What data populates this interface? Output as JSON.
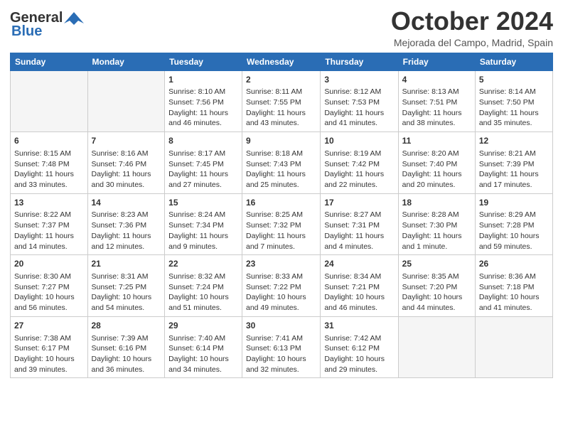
{
  "header": {
    "logo_line1": "General",
    "logo_line2": "Blue",
    "month": "October 2024",
    "location": "Mejorada del Campo, Madrid, Spain"
  },
  "days_of_week": [
    "Sunday",
    "Monday",
    "Tuesday",
    "Wednesday",
    "Thursday",
    "Friday",
    "Saturday"
  ],
  "weeks": [
    [
      {
        "day": "",
        "empty": true
      },
      {
        "day": "",
        "empty": true
      },
      {
        "day": "1",
        "sunrise": "Sunrise: 8:10 AM",
        "sunset": "Sunset: 7:56 PM",
        "daylight": "Daylight: 11 hours and 46 minutes."
      },
      {
        "day": "2",
        "sunrise": "Sunrise: 8:11 AM",
        "sunset": "Sunset: 7:55 PM",
        "daylight": "Daylight: 11 hours and 43 minutes."
      },
      {
        "day": "3",
        "sunrise": "Sunrise: 8:12 AM",
        "sunset": "Sunset: 7:53 PM",
        "daylight": "Daylight: 11 hours and 41 minutes."
      },
      {
        "day": "4",
        "sunrise": "Sunrise: 8:13 AM",
        "sunset": "Sunset: 7:51 PM",
        "daylight": "Daylight: 11 hours and 38 minutes."
      },
      {
        "day": "5",
        "sunrise": "Sunrise: 8:14 AM",
        "sunset": "Sunset: 7:50 PM",
        "daylight": "Daylight: 11 hours and 35 minutes."
      }
    ],
    [
      {
        "day": "6",
        "sunrise": "Sunrise: 8:15 AM",
        "sunset": "Sunset: 7:48 PM",
        "daylight": "Daylight: 11 hours and 33 minutes."
      },
      {
        "day": "7",
        "sunrise": "Sunrise: 8:16 AM",
        "sunset": "Sunset: 7:46 PM",
        "daylight": "Daylight: 11 hours and 30 minutes."
      },
      {
        "day": "8",
        "sunrise": "Sunrise: 8:17 AM",
        "sunset": "Sunset: 7:45 PM",
        "daylight": "Daylight: 11 hours and 27 minutes."
      },
      {
        "day": "9",
        "sunrise": "Sunrise: 8:18 AM",
        "sunset": "Sunset: 7:43 PM",
        "daylight": "Daylight: 11 hours and 25 minutes."
      },
      {
        "day": "10",
        "sunrise": "Sunrise: 8:19 AM",
        "sunset": "Sunset: 7:42 PM",
        "daylight": "Daylight: 11 hours and 22 minutes."
      },
      {
        "day": "11",
        "sunrise": "Sunrise: 8:20 AM",
        "sunset": "Sunset: 7:40 PM",
        "daylight": "Daylight: 11 hours and 20 minutes."
      },
      {
        "day": "12",
        "sunrise": "Sunrise: 8:21 AM",
        "sunset": "Sunset: 7:39 PM",
        "daylight": "Daylight: 11 hours and 17 minutes."
      }
    ],
    [
      {
        "day": "13",
        "sunrise": "Sunrise: 8:22 AM",
        "sunset": "Sunset: 7:37 PM",
        "daylight": "Daylight: 11 hours and 14 minutes."
      },
      {
        "day": "14",
        "sunrise": "Sunrise: 8:23 AM",
        "sunset": "Sunset: 7:36 PM",
        "daylight": "Daylight: 11 hours and 12 minutes."
      },
      {
        "day": "15",
        "sunrise": "Sunrise: 8:24 AM",
        "sunset": "Sunset: 7:34 PM",
        "daylight": "Daylight: 11 hours and 9 minutes."
      },
      {
        "day": "16",
        "sunrise": "Sunrise: 8:25 AM",
        "sunset": "Sunset: 7:32 PM",
        "daylight": "Daylight: 11 hours and 7 minutes."
      },
      {
        "day": "17",
        "sunrise": "Sunrise: 8:27 AM",
        "sunset": "Sunset: 7:31 PM",
        "daylight": "Daylight: 11 hours and 4 minutes."
      },
      {
        "day": "18",
        "sunrise": "Sunrise: 8:28 AM",
        "sunset": "Sunset: 7:30 PM",
        "daylight": "Daylight: 11 hours and 1 minute."
      },
      {
        "day": "19",
        "sunrise": "Sunrise: 8:29 AM",
        "sunset": "Sunset: 7:28 PM",
        "daylight": "Daylight: 10 hours and 59 minutes."
      }
    ],
    [
      {
        "day": "20",
        "sunrise": "Sunrise: 8:30 AM",
        "sunset": "Sunset: 7:27 PM",
        "daylight": "Daylight: 10 hours and 56 minutes."
      },
      {
        "day": "21",
        "sunrise": "Sunrise: 8:31 AM",
        "sunset": "Sunset: 7:25 PM",
        "daylight": "Daylight: 10 hours and 54 minutes."
      },
      {
        "day": "22",
        "sunrise": "Sunrise: 8:32 AM",
        "sunset": "Sunset: 7:24 PM",
        "daylight": "Daylight: 10 hours and 51 minutes."
      },
      {
        "day": "23",
        "sunrise": "Sunrise: 8:33 AM",
        "sunset": "Sunset: 7:22 PM",
        "daylight": "Daylight: 10 hours and 49 minutes."
      },
      {
        "day": "24",
        "sunrise": "Sunrise: 8:34 AM",
        "sunset": "Sunset: 7:21 PM",
        "daylight": "Daylight: 10 hours and 46 minutes."
      },
      {
        "day": "25",
        "sunrise": "Sunrise: 8:35 AM",
        "sunset": "Sunset: 7:20 PM",
        "daylight": "Daylight: 10 hours and 44 minutes."
      },
      {
        "day": "26",
        "sunrise": "Sunrise: 8:36 AM",
        "sunset": "Sunset: 7:18 PM",
        "daylight": "Daylight: 10 hours and 41 minutes."
      }
    ],
    [
      {
        "day": "27",
        "sunrise": "Sunrise: 7:38 AM",
        "sunset": "Sunset: 6:17 PM",
        "daylight": "Daylight: 10 hours and 39 minutes."
      },
      {
        "day": "28",
        "sunrise": "Sunrise: 7:39 AM",
        "sunset": "Sunset: 6:16 PM",
        "daylight": "Daylight: 10 hours and 36 minutes."
      },
      {
        "day": "29",
        "sunrise": "Sunrise: 7:40 AM",
        "sunset": "Sunset: 6:14 PM",
        "daylight": "Daylight: 10 hours and 34 minutes."
      },
      {
        "day": "30",
        "sunrise": "Sunrise: 7:41 AM",
        "sunset": "Sunset: 6:13 PM",
        "daylight": "Daylight: 10 hours and 32 minutes."
      },
      {
        "day": "31",
        "sunrise": "Sunrise: 7:42 AM",
        "sunset": "Sunset: 6:12 PM",
        "daylight": "Daylight: 10 hours and 29 minutes."
      },
      {
        "day": "",
        "empty": true
      },
      {
        "day": "",
        "empty": true
      }
    ]
  ]
}
